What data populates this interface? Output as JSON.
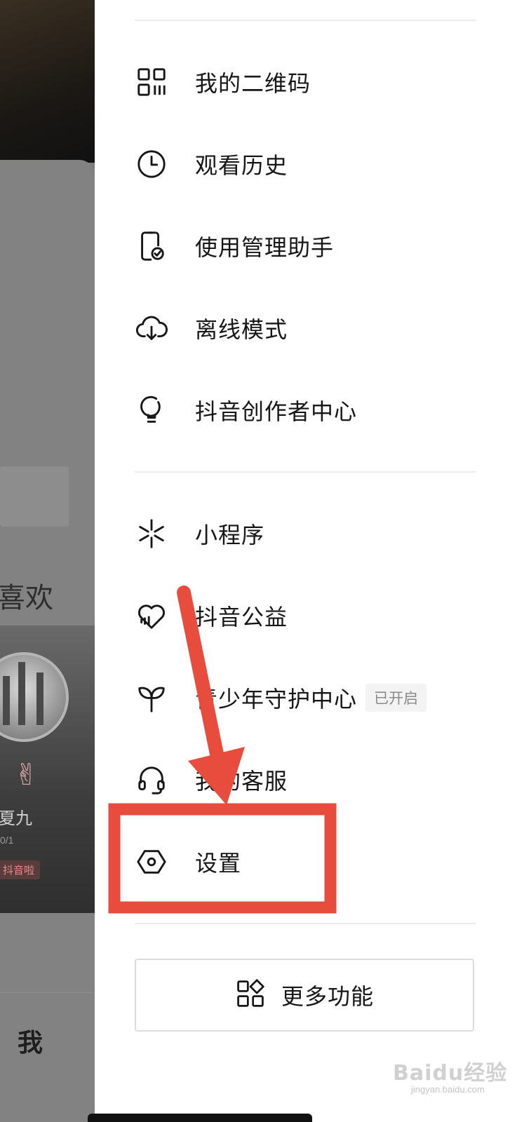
{
  "background_profile": {
    "like_label": "喜欢",
    "video_author": "夏九",
    "video_meta": "0/1",
    "video_tag": "抖音啦",
    "bottom_tab_me": "我"
  },
  "menu": {
    "group1": [
      {
        "label": "我的二维码",
        "icon": "qr-code-icon"
      },
      {
        "label": "观看历史",
        "icon": "clock-icon"
      },
      {
        "label": "使用管理助手",
        "icon": "phone-check-icon"
      },
      {
        "label": "离线模式",
        "icon": "cloud-download-icon"
      },
      {
        "label": "抖音创作者中心",
        "icon": "lightbulb-icon"
      }
    ],
    "group2": [
      {
        "label": "小程序",
        "icon": "mini-program-icon"
      },
      {
        "label": "抖音公益",
        "icon": "charity-heart-icon"
      },
      {
        "label": "青少年守护中心",
        "icon": "sprout-icon",
        "badge": "已开启"
      },
      {
        "label": "我的客服",
        "icon": "headset-icon"
      },
      {
        "label": "设置",
        "icon": "settings-hexagon-icon"
      }
    ]
  },
  "more_button": {
    "label": "更多功能",
    "icon": "grid-shapes-icon"
  },
  "annotation": {
    "color": "#e74c3c",
    "target": "设置"
  },
  "watermark": {
    "text": "Baidu经验",
    "sub": "jingyan.baidu.com"
  },
  "colors": {
    "text": "#161616",
    "divider": "#ececec",
    "dim_overlay": "#7d7d7d",
    "badge_bg": "#f3f3f3"
  }
}
